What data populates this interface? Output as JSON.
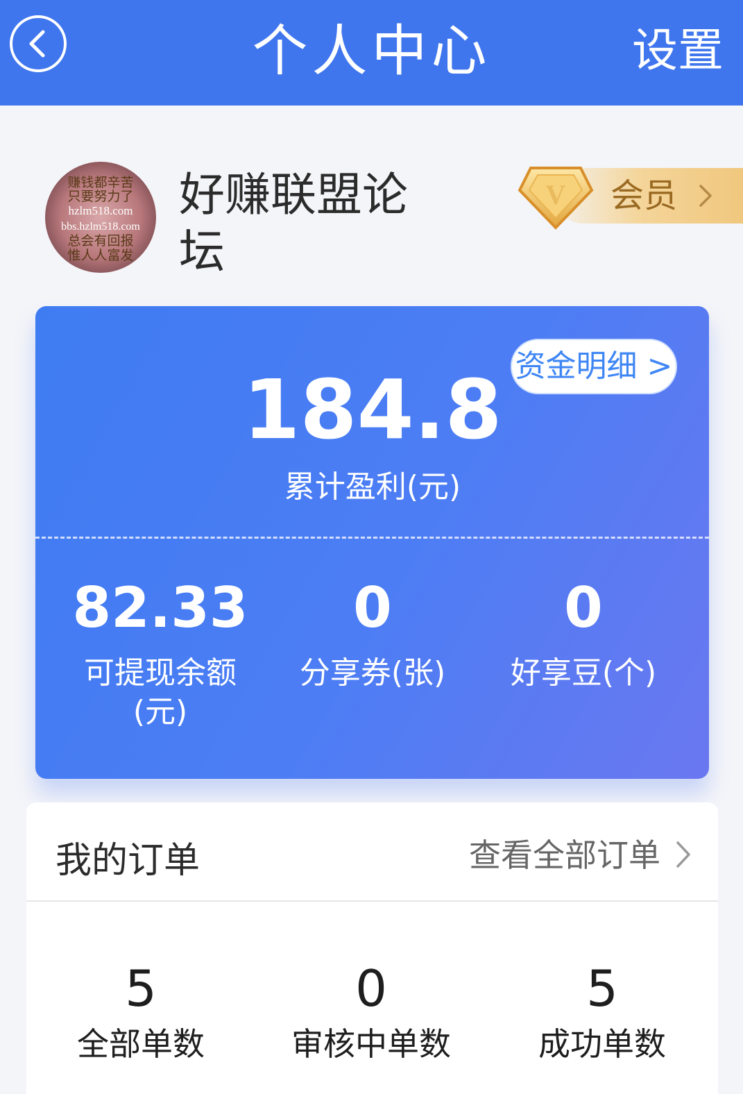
{
  "header": {
    "title": "个人中心",
    "settings_label": "设置",
    "bg_color": "#3f76ee"
  },
  "profile": {
    "avatar_text": [
      "赚钱都辛苦",
      "只要努力了",
      "hzlm518.com",
      "bbs.hzlm518.com",
      "总会有回报",
      "惟人人富发"
    ],
    "username": "好赚联盟论坛",
    "member_label": "会员",
    "member_badge_letter": "V"
  },
  "earnings": {
    "fund_detail_label": "资金明细 >",
    "total_profit": "184.8",
    "total_profit_label": "累计盈利(元)",
    "stats": [
      {
        "value": "82.33",
        "label": "可提现余额(元)"
      },
      {
        "value": "0",
        "label": "分享券(张)"
      },
      {
        "value": "0",
        "label": "好享豆(个)"
      }
    ]
  },
  "orders": {
    "title": "我的订单",
    "view_all_label": "查看全部订单",
    "stats": [
      {
        "value": "5",
        "label": "全部单数"
      },
      {
        "value": "0",
        "label": "审核中单数"
      },
      {
        "value": "5",
        "label": "成功单数"
      }
    ]
  }
}
